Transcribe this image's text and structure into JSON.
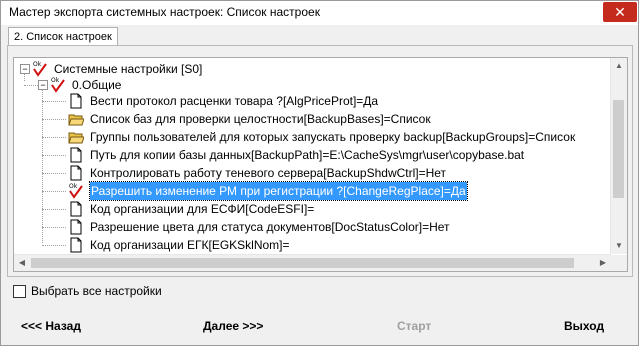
{
  "window": {
    "title": "Мастер экспорта системных настроек:  Список настроек",
    "close_glyph": "✕"
  },
  "tab": {
    "label": "2. Список настроек"
  },
  "tree": {
    "root": {
      "label": "Системные настройки [S0]",
      "checked": true,
      "expander": "−"
    },
    "group": {
      "label": "0.Общие",
      "checked": true,
      "expander": "−"
    },
    "items": [
      {
        "label": "Вести протокол расценки товара ?[AlgPriceProt]=Да",
        "icon": "document-icon",
        "checked": false,
        "selected": false
      },
      {
        "label": "Список баз для проверки целостности[BackupBases]=Список",
        "icon": "folder-icon",
        "checked": false,
        "selected": false
      },
      {
        "label": "Группы пользователей для которых запускать проверку backup[BackupGroups]=Список",
        "icon": "folder-icon",
        "checked": false,
        "selected": false
      },
      {
        "label": "Путь для копии базы данных[BackupPath]=E:\\CacheSys\\mgr\\user\\copybase.bat",
        "icon": "document-icon",
        "checked": false,
        "selected": false
      },
      {
        "label": "Контролировать работу теневого сервера[BackupShdwCtrl]=Нет",
        "icon": "document-icon",
        "checked": false,
        "selected": false
      },
      {
        "label": "Разрешить изменение РМ при регистрации ?[ChangeRegPlace]=Да",
        "icon": "document-icon",
        "checked": true,
        "selected": true
      },
      {
        "label": "Код организации для ЕСФИ[CodeESFI]=",
        "icon": "document-icon",
        "checked": false,
        "selected": false
      },
      {
        "label": "Разрешение цвета для статуса документов[DocStatusColor]=Нет",
        "icon": "document-icon",
        "checked": false,
        "selected": false
      },
      {
        "label": "Код организации ЕГК[EGKSklNom]=",
        "icon": "document-icon",
        "checked": false,
        "selected": false
      }
    ],
    "check_mark_text": "Ok",
    "colors": {
      "check": "#d01010",
      "selection": "#3399ff",
      "folder": "#e8c24a"
    }
  },
  "select_all": {
    "label": "Выбрать все настройки",
    "checked": false
  },
  "buttons": {
    "back": "<<< Назад",
    "next": "Далее >>>",
    "start": "Старт",
    "exit": "Выход"
  }
}
